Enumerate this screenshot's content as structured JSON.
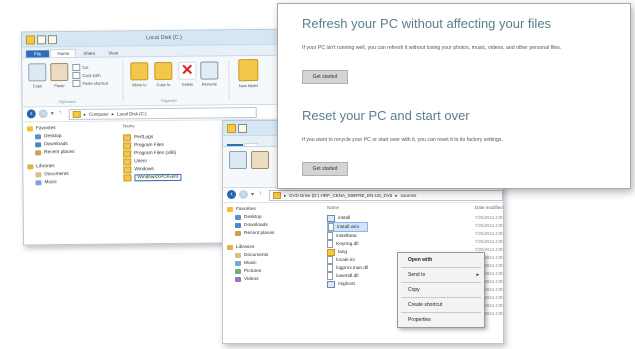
{
  "win1": {
    "title": "Local Disk (C:)",
    "tabs": [
      "File",
      "Home",
      "Share",
      "View"
    ],
    "ribbon": {
      "copy": "Copy",
      "paste": "Paste",
      "cut": "Cut",
      "copy_path": "Copy path",
      "paste_shortcut": "Paste shortcut",
      "move_to": "Move to",
      "copy_to": "Copy to",
      "delete": "Delete",
      "rename": "Rename",
      "new_folder": "New folder",
      "clipboard_group": "Clipboard",
      "organize_group": "Organize"
    },
    "address": [
      "Computer",
      "Local Disk (C:)"
    ],
    "nav": {
      "favorites": "Favorites",
      "desktop": "Desktop",
      "downloads": "Downloads",
      "recent_places": "Recent places",
      "libraries": "Libraries",
      "documents": "Documents",
      "music": "Music"
    },
    "column_name": "Name",
    "files": [
      "PerfLogs",
      "Program Files",
      "Program Files (x86)",
      "Users",
      "Windows"
    ],
    "rename_value": "WindowsXPDrivers"
  },
  "win2": {
    "address": "DVD Drive (D:) HRP_CENA_X86FRE_EN-US_DV5",
    "address_tail": "sources",
    "column_name": "Name",
    "column_date": "Date modified",
    "nav": {
      "favorites": "Favorites",
      "desktop": "Desktop",
      "downloads": "Downloads",
      "recent_places": "Recent places",
      "libraries": "Libraries",
      "documents": "Documents",
      "music": "Music",
      "pictures": "Pictures",
      "videos": "Videos"
    },
    "files": [
      "install",
      "install.wim",
      "instelbeta",
      "Keyring.dll",
      "lang",
      "locale.ini",
      "logprov.man.dll",
      "loweridl.dll",
      "mighost"
    ],
    "dates": [
      "7/25/2012 4:00 PM",
      "7/25/2012 4:00 PM",
      "7/25/2012 4:00 PM",
      "7/25/2012 4:00 PM",
      "7/25/2012 4:00 PM",
      "7/25/2012 4:00 PM",
      "7/25/2012 4:00 PM",
      "7/25/2012 4:00 PM",
      "7/25/2012 4:00 PM",
      "7/25/2012 4:00 PM",
      "7/25/2012 4:00 PM",
      "7/25/2012 4:00 PM",
      "7/25/2012 4:00 PM"
    ]
  },
  "context_menu": {
    "open_with": "Open with",
    "send_to": "Send to",
    "copy": "Copy",
    "create_shortcut": "Create shortcut",
    "properties": "Properties"
  },
  "panel": {
    "refresh_title": "Refresh your PC without affecting your files",
    "refresh_desc": "If your PC isn't running well, you can refresh it without losing your photos, music, videos, and other personal files.",
    "refresh_button": "Get started",
    "reset_title": "Reset your PC and start over",
    "reset_desc": "If you want to recycle your PC or start over with it, you can reset it to its factory settings.",
    "reset_button": "Get started"
  },
  "colors": {
    "accent": "#2a6fb8",
    "folder": "#f3c84a",
    "heading": "#5a7f8a",
    "selection": "#cfe4f8"
  }
}
